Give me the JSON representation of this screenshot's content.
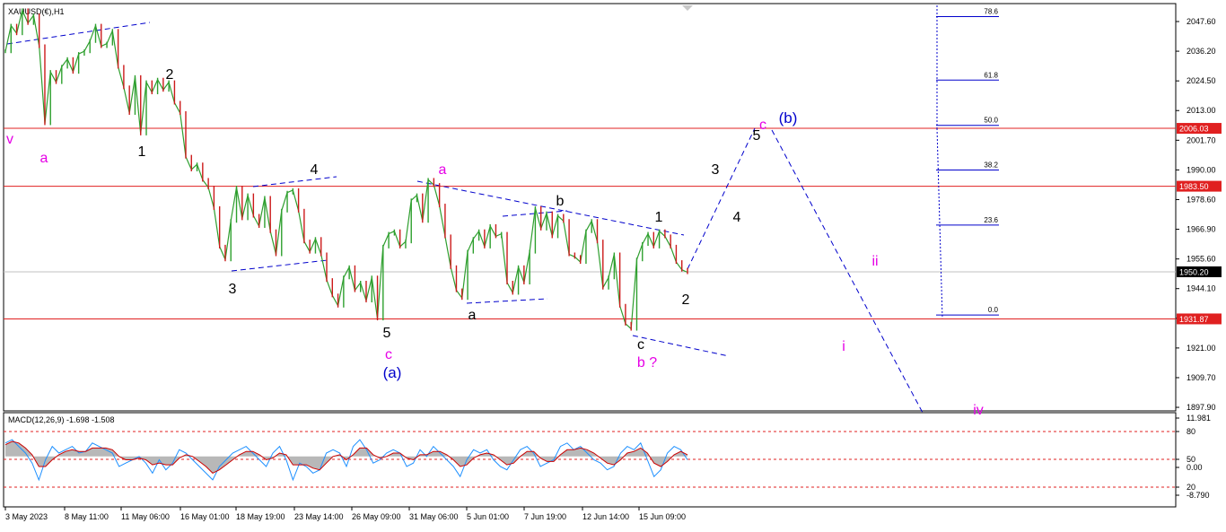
{
  "chart_data": [
    {
      "type": "line",
      "title": "XAUUSD(€),H1",
      "ylim": [
        1897.9,
        2053.0
      ],
      "price_ticks": [
        "2047.60",
        "2036.20",
        "2024.50",
        "2013.00",
        "2001.70",
        "1990.00",
        "1978.60",
        "1966.90",
        "1955.60",
        "1944.10",
        "1932.70",
        "1921.00",
        "1909.70",
        "1897.90"
      ],
      "x_tick_labels": [
        "3 May 2023",
        "8 May 11:00",
        "11 May 06:00",
        "16 May 01:00",
        "18 May 19:00",
        "23 May 14:00",
        "26 May 09:00",
        "31 May 06:00",
        "5 Jun 01:00",
        "7 Jun 19:00",
        "12 Jun 14:00",
        "15 Jun 09:00"
      ],
      "series": [
        {
          "values": [
            2036,
            2046,
            2043,
            2052,
            2047,
            2050,
            2038,
            2008,
            2028,
            2024,
            2030,
            2033,
            2028,
            2035,
            2036,
            2040,
            2046,
            2038,
            2039,
            2044,
            2030,
            2022,
            2012,
            2026,
            2004,
            2024,
            2020,
            2025,
            2021,
            2024,
            2016,
            2012,
            1995,
            1990,
            1992,
            1986,
            1983,
            1975,
            1960,
            1955,
            1970,
            1983,
            1971,
            1980,
            1972,
            1968,
            1979,
            1966,
            1957,
            1974,
            1981,
            1982,
            1974,
            1962,
            1958,
            1963,
            1957,
            1947,
            1941,
            1937,
            1948,
            1952,
            1943,
            1946,
            1939,
            1948,
            1932,
            1960,
            1965,
            1966,
            1960,
            1962,
            1978,
            1980,
            1970,
            1986,
            1984,
            1976,
            1964,
            1952,
            1943,
            1940,
            1958,
            1963,
            1966,
            1960,
            1968,
            1964,
            1965,
            1946,
            1942,
            1952,
            1946,
            1958,
            1975,
            1967,
            1973,
            1964,
            1972,
            1970,
            1957,
            1956,
            1954,
            1966,
            1970,
            1962,
            1944,
            1948,
            1957,
            1937,
            1930,
            1928,
            1955,
            1961,
            1965,
            1960,
            1966,
            1964,
            1960,
            1954,
            1951,
            1950
          ]
        }
      ],
      "current_price": 1950.2,
      "horizontal_levels": [
        {
          "value": 2006.03,
          "label": "2006.03"
        },
        {
          "value": 1983.5,
          "label": "1983.50"
        },
        {
          "value": 1931.87,
          "label": "1931.87"
        }
      ],
      "current_price_label": "1950.20",
      "fibonacci": [
        {
          "label": "78.6",
          "value": 2049.5
        },
        {
          "label": "61.8",
          "value": 2024.8
        },
        {
          "label": "50.0",
          "value": 2007.2
        },
        {
          "label": "38.2",
          "value": 1989.8
        },
        {
          "label": "23.6",
          "value": 1968.4
        },
        {
          "label": "0.0",
          "value": 1933.4
        }
      ],
      "wave_labels": [
        {
          "text": "v",
          "color": "#e600e6"
        },
        {
          "text": "a",
          "color": "#e600e6"
        },
        {
          "text": "1",
          "color": "#000000"
        },
        {
          "text": "2",
          "color": "#000000"
        },
        {
          "text": "3",
          "color": "#000000"
        },
        {
          "text": "4",
          "color": "#000000"
        },
        {
          "text": "5",
          "color": "#000000"
        },
        {
          "text": "c",
          "color": "#e600e6"
        },
        {
          "text": "(a)",
          "color": "#0000cc"
        },
        {
          "text": "a",
          "color": "#e600e6"
        },
        {
          "text": "a",
          "color": "#000000"
        },
        {
          "text": "b",
          "color": "#000000"
        },
        {
          "text": "c",
          "color": "#000000"
        },
        {
          "text": "b ?",
          "color": "#e600e6"
        },
        {
          "text": "1",
          "color": "#000000"
        },
        {
          "text": "2",
          "color": "#000000"
        },
        {
          "text": "3",
          "color": "#000000"
        },
        {
          "text": "4",
          "color": "#000000"
        },
        {
          "text": "5",
          "color": "#000000"
        },
        {
          "text": "c",
          "color": "#e600e6"
        },
        {
          "text": "(b)",
          "color": "#0000cc"
        },
        {
          "text": "ii",
          "color": "#e600e6"
        },
        {
          "text": "i",
          "color": "#e600e6"
        },
        {
          "text": "iv",
          "color": "#e600e6"
        }
      ]
    },
    {
      "type": "line",
      "title": "MACD(12,26,9) -1.698 -1.508",
      "ylim": [
        -28.0,
        24.0
      ],
      "y_tick_labels": [
        "11.981",
        "80",
        "50",
        "0.00",
        "20",
        "-8.790"
      ],
      "series": [
        {
          "name": "MACD",
          "values": [
            8,
            10,
            6,
            2,
            -4,
            -14,
            -2,
            6,
            2,
            4,
            6,
            2,
            3,
            8,
            6,
            4,
            2,
            -6,
            -4,
            -2,
            0,
            -4,
            -10,
            -2,
            -8,
            -4,
            4,
            2,
            -2,
            -6,
            -10,
            -14,
            -6,
            -2,
            2,
            4,
            6,
            2,
            -2,
            -6,
            2,
            6,
            -2,
            -14,
            -4,
            -6,
            -10,
            -8,
            2,
            4,
            2,
            -6,
            6,
            10,
            4,
            -4,
            -2,
            2,
            4,
            2,
            -6,
            -4,
            4,
            0,
            6,
            2,
            -2,
            -6,
            -12,
            -2,
            4,
            2,
            4,
            -2,
            -6,
            -8,
            -2,
            4,
            6,
            2,
            -6,
            -4,
            -2,
            6,
            8,
            4,
            6,
            2,
            -2,
            -4,
            -8,
            -6,
            2,
            6,
            4,
            8,
            -2,
            -12,
            -8,
            2,
            6,
            4,
            -2
          ],
          "color": "#1e90ff"
        },
        {
          "name": "Signal",
          "values": [
            7,
            9,
            8,
            5,
            1,
            -6,
            -6,
            -2,
            1,
            3,
            4,
            3,
            3,
            5,
            5,
            5,
            4,
            0,
            -2,
            -2,
            -1,
            -2,
            -5,
            -4,
            -5,
            -5,
            -1,
            1,
            0,
            -3,
            -6,
            -10,
            -8,
            -5,
            -2,
            1,
            3,
            3,
            1,
            -2,
            -1,
            2,
            1,
            -5,
            -5,
            -5,
            -7,
            -8,
            -4,
            0,
            1,
            -2,
            1,
            5,
            5,
            1,
            -1,
            0,
            2,
            2,
            -1,
            -2,
            1,
            1,
            3,
            3,
            1,
            -2,
            -6,
            -5,
            -1,
            1,
            2,
            1,
            -2,
            -5,
            -4,
            0,
            3,
            3,
            -1,
            -3,
            -3,
            1,
            4,
            4,
            5,
            4,
            2,
            -1,
            -4,
            -5,
            -2,
            2,
            3,
            5,
            2,
            -4,
            -6,
            -3,
            1,
            3,
            1
          ],
          "color": "#cc0000"
        }
      ]
    }
  ]
}
